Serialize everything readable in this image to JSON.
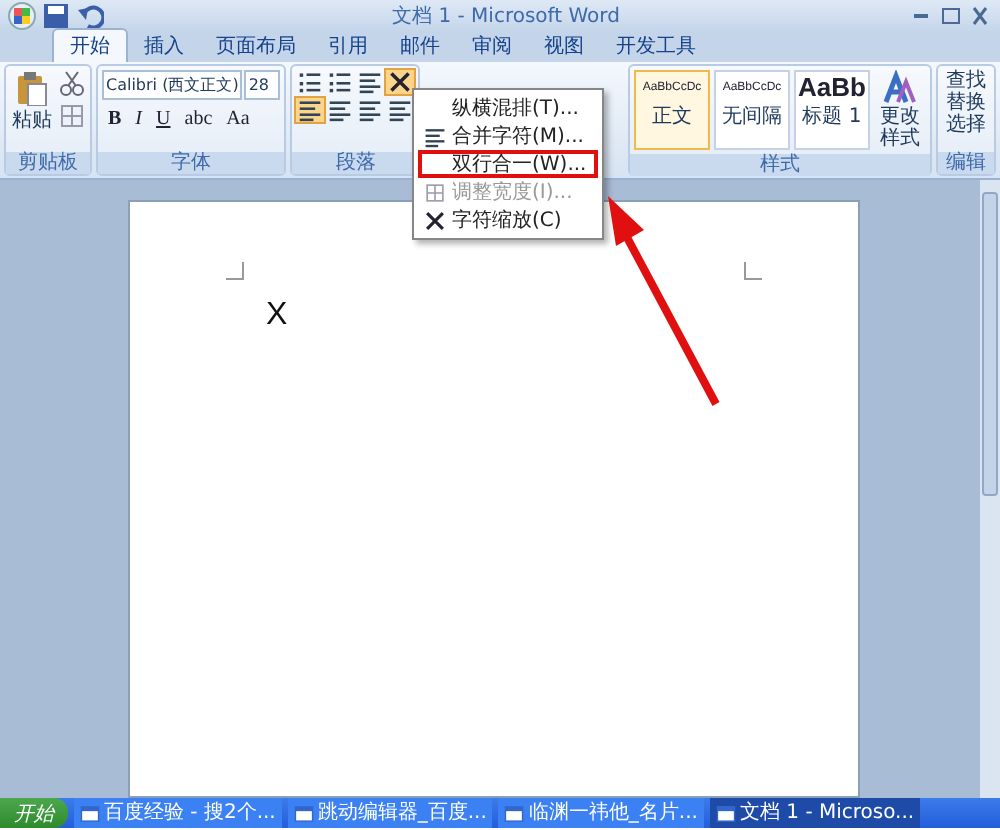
{
  "window": {
    "title": "文档 1 - Microsoft Word"
  },
  "tabs": [
    {
      "label": "开始",
      "selected": true
    },
    {
      "label": "插入",
      "selected": false
    },
    {
      "label": "页面布局",
      "selected": false
    },
    {
      "label": "引用",
      "selected": false
    },
    {
      "label": "邮件",
      "selected": false
    },
    {
      "label": "审阅",
      "selected": false
    },
    {
      "label": "视图",
      "selected": false
    },
    {
      "label": "开发工具",
      "selected": false
    }
  ],
  "ribbon": {
    "clipboard": {
      "paste": "粘贴",
      "label": "剪贴板"
    },
    "font": {
      "name": "Calibri (西文正文)",
      "size": "28",
      "label": "字体",
      "format_buttons": [
        "B",
        "I",
        "U",
        "abc",
        "Aa"
      ]
    },
    "paragraph": {
      "label": "段落"
    },
    "styles": {
      "items": [
        {
          "preview": "AaBbCcDc",
          "name": "正文",
          "selected": true
        },
        {
          "preview": "AaBbCcDc",
          "name": "无间隔",
          "selected": false
        },
        {
          "preview": "AaBb",
          "name": "标题 1",
          "selected": false
        }
      ],
      "change": "更改样式",
      "label": "样式"
    },
    "editing": {
      "items": [
        "查找",
        "替换",
        "选择"
      ],
      "label": "编辑"
    }
  },
  "menu": {
    "items": [
      {
        "label": "纵横混排(T)...",
        "disabled": false,
        "marked": false
      },
      {
        "label": "合并字符(M)...",
        "disabled": false,
        "marked": false
      },
      {
        "label": "双行合一(W)...",
        "disabled": false,
        "marked": true
      },
      {
        "label": "调整宽度(I)...",
        "disabled": true,
        "marked": false
      },
      {
        "label": "字符缩放(C)",
        "disabled": false,
        "marked": false
      }
    ]
  },
  "document": {
    "text": "X"
  },
  "taskbar": {
    "start": "开始",
    "tasks": [
      {
        "label": "百度经验 - 搜2个...",
        "selected": false
      },
      {
        "label": "跳动编辑器_百度...",
        "selected": false
      },
      {
        "label": "临渊一祎他_名片...",
        "selected": false
      },
      {
        "label": "文档 1 - Microso...",
        "selected": true
      }
    ]
  }
}
